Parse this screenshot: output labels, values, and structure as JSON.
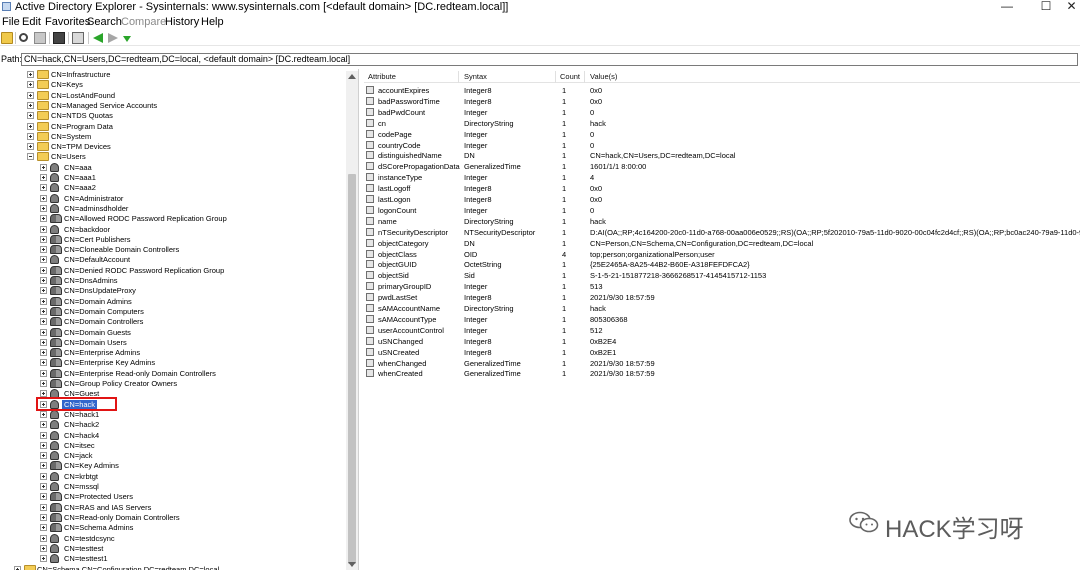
{
  "window": {
    "title": "Active Directory Explorer - Sysinternals: www.sysinternals.com [<default domain> [DC.redteam.local]]",
    "minimize": "—",
    "maximize": "☐",
    "close": "✕"
  },
  "menu": [
    "File",
    "Edit",
    "Favorites",
    "Search",
    "Compare",
    "History",
    "Help"
  ],
  "path": {
    "label": "Path:",
    "value": "CN=hack,CN=Users,DC=redteam,DC=local, <default domain> [DC.redteam.local]"
  },
  "tree": {
    "top_nodes": [
      "CN=Infrastructure",
      "CN=Keys",
      "CN=LostAndFound",
      "CN=Managed Service Accounts",
      "CN=NTDS Quotas",
      "CN=Program Data",
      "CN=System",
      "CN=TPM Devices",
      "CN=Users"
    ],
    "users_children": [
      {
        "label": "CN=aaa",
        "kind": "user"
      },
      {
        "label": "CN=aaa1",
        "kind": "user"
      },
      {
        "label": "CN=aaa2",
        "kind": "user"
      },
      {
        "label": "CN=Administrator",
        "kind": "user"
      },
      {
        "label": "CN=adminsdholder",
        "kind": "user"
      },
      {
        "label": "CN=Allowed RODC Password Replication Group",
        "kind": "group"
      },
      {
        "label": "CN=backdoor",
        "kind": "user"
      },
      {
        "label": "CN=Cert Publishers",
        "kind": "group"
      },
      {
        "label": "CN=Cloneable Domain Controllers",
        "kind": "group"
      },
      {
        "label": "CN=DefaultAccount",
        "kind": "user"
      },
      {
        "label": "CN=Denied RODC Password Replication Group",
        "kind": "group"
      },
      {
        "label": "CN=DnsAdmins",
        "kind": "group"
      },
      {
        "label": "CN=DnsUpdateProxy",
        "kind": "group"
      },
      {
        "label": "CN=Domain Admins",
        "kind": "group"
      },
      {
        "label": "CN=Domain Computers",
        "kind": "group"
      },
      {
        "label": "CN=Domain Controllers",
        "kind": "group"
      },
      {
        "label": "CN=Domain Guests",
        "kind": "group"
      },
      {
        "label": "CN=Domain Users",
        "kind": "group"
      },
      {
        "label": "CN=Enterprise Admins",
        "kind": "group"
      },
      {
        "label": "CN=Enterprise Key Admins",
        "kind": "group"
      },
      {
        "label": "CN=Enterprise Read-only Domain Controllers",
        "kind": "group"
      },
      {
        "label": "CN=Group Policy Creator Owners",
        "kind": "group"
      },
      {
        "label": "CN=Guest",
        "kind": "user"
      },
      {
        "label": "CN=hack",
        "kind": "user",
        "selected": true
      },
      {
        "label": "CN=hack1",
        "kind": "user"
      },
      {
        "label": "CN=hack2",
        "kind": "user"
      },
      {
        "label": "CN=hack4",
        "kind": "user"
      },
      {
        "label": "CN=itsec",
        "kind": "user"
      },
      {
        "label": "CN=jack",
        "kind": "user"
      },
      {
        "label": "CN=Key Admins",
        "kind": "group"
      },
      {
        "label": "CN=krbtgt",
        "kind": "user"
      },
      {
        "label": "CN=mssql",
        "kind": "user"
      },
      {
        "label": "CN=Protected Users",
        "kind": "group"
      },
      {
        "label": "CN=RAS and IAS Servers",
        "kind": "group"
      },
      {
        "label": "CN=Read-only Domain Controllers",
        "kind": "group"
      },
      {
        "label": "CN=Schema Admins",
        "kind": "group"
      },
      {
        "label": "CN=testdcsync",
        "kind": "user"
      },
      {
        "label": "CN=testtest",
        "kind": "user"
      },
      {
        "label": "CN=testtest1",
        "kind": "user"
      }
    ],
    "bottom_node": "CN=Schema,CN=Configuration,DC=redteam,DC=local"
  },
  "table": {
    "columns": [
      "Attribute",
      "Syntax",
      "Count",
      "Value(s)"
    ],
    "rows": [
      [
        "accountExpires",
        "Integer8",
        "1",
        "0x0"
      ],
      [
        "badPasswordTime",
        "Integer8",
        "1",
        "0x0"
      ],
      [
        "badPwdCount",
        "Integer",
        "1",
        "0"
      ],
      [
        "cn",
        "DirectoryString",
        "1",
        "hack"
      ],
      [
        "codePage",
        "Integer",
        "1",
        "0"
      ],
      [
        "countryCode",
        "Integer",
        "1",
        "0"
      ],
      [
        "distinguishedName",
        "DN",
        "1",
        "CN=hack,CN=Users,DC=redteam,DC=local"
      ],
      [
        "dSCorePropagationData",
        "GeneralizedTime",
        "1",
        "1601/1/1 8:00:00"
      ],
      [
        "instanceType",
        "Integer",
        "1",
        "4"
      ],
      [
        "lastLogoff",
        "Integer8",
        "1",
        "0x0"
      ],
      [
        "lastLogon",
        "Integer8",
        "1",
        "0x0"
      ],
      [
        "logonCount",
        "Integer",
        "1",
        "0"
      ],
      [
        "name",
        "DirectoryString",
        "1",
        "hack"
      ],
      [
        "nTSecurityDescriptor",
        "NTSecurityDescriptor",
        "1",
        "D:AI(OA;;RP;4c164200-20c0-11d0-a768-00aa006e0529;;RS)(OA;;RP;5f202010-79a5-11d0-9020-00c04fc2d4cf;;RS)(OA;;RP;bc0ac240-79a9-11d0-9020-00c"
      ],
      [
        "objectCategory",
        "DN",
        "1",
        "CN=Person,CN=Schema,CN=Configuration,DC=redteam,DC=local"
      ],
      [
        "objectClass",
        "OID",
        "4",
        "top;person;organizationalPerson;user"
      ],
      [
        "objectGUID",
        "OctetString",
        "1",
        "{25E2465A-8A25-44B2-B60E-A318FEFDFCA2}"
      ],
      [
        "objectSid",
        "Sid",
        "1",
        "S-1-5-21-151877218-3666268517-4145415712-1153"
      ],
      [
        "primaryGroupID",
        "Integer",
        "1",
        "513"
      ],
      [
        "pwdLastSet",
        "Integer8",
        "1",
        "2021/9/30 18:57:59"
      ],
      [
        "sAMAccountName",
        "DirectoryString",
        "1",
        "hack"
      ],
      [
        "sAMAccountType",
        "Integer",
        "1",
        "805306368"
      ],
      [
        "userAccountControl",
        "Integer",
        "1",
        "512"
      ],
      [
        "uSNChanged",
        "Integer8",
        "1",
        "0xB2E4"
      ],
      [
        "uSNCreated",
        "Integer8",
        "1",
        "0xB2E1"
      ],
      [
        "whenChanged",
        "GeneralizedTime",
        "1",
        "2021/9/30 18:57:59"
      ],
      [
        "whenCreated",
        "GeneralizedTime",
        "1",
        "2021/9/30 18:57:59"
      ]
    ]
  },
  "watermark": {
    "text": "HACK学习呀",
    "icon": "wechat-icon"
  }
}
